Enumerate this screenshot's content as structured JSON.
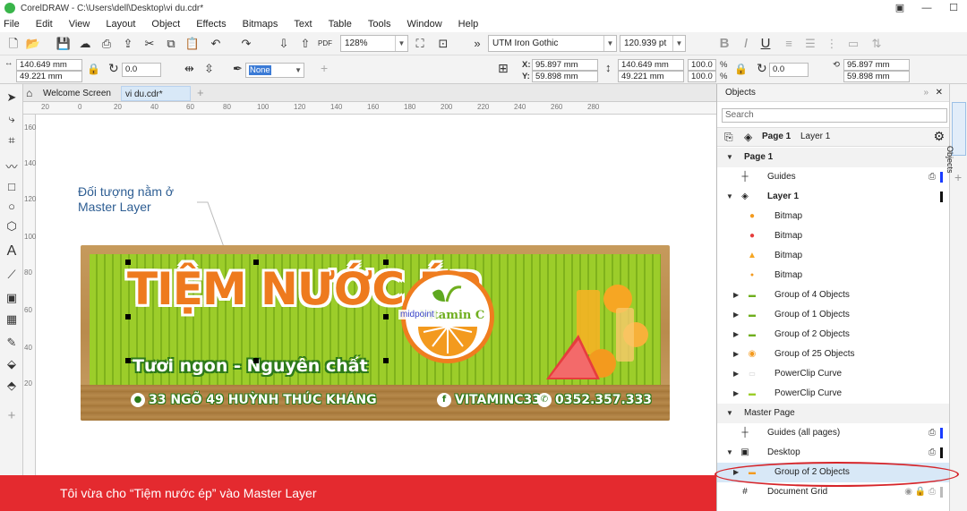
{
  "window": {
    "title": "CorelDRAW - C:\\Users\\dell\\Desktop\\vi du.cdr*"
  },
  "menu": [
    "File",
    "Edit",
    "View",
    "Layout",
    "Object",
    "Effects",
    "Bitmaps",
    "Text",
    "Table",
    "Tools",
    "Window",
    "Help"
  ],
  "toolbar": {
    "zoom": "128%",
    "font": "UTM Iron Gothic",
    "font_size": "120.939 pt",
    "bold": "B",
    "italic": "I",
    "underline": "U",
    "pdf": "PDF"
  },
  "propbar": {
    "width": "140.649 mm",
    "height": "49.221 mm",
    "angle": "0.0",
    "outline": "None",
    "x_label": "X:",
    "y_label": "Y:",
    "x": "95.897 mm",
    "y": "59.898 mm",
    "w2": "140.649 mm",
    "h2": "49.221 mm",
    "sx": "100.0",
    "sy": "100.0",
    "pct": "%",
    "rot": "0.0",
    "cx": "95.897 mm",
    "cy": "59.898 mm"
  },
  "tabs": {
    "welcome": "Welcome Screen",
    "doc": "vi du.cdr*"
  },
  "ruler": {
    "h": [
      "20",
      "0",
      "20",
      "40",
      "60",
      "80",
      "100",
      "120",
      "140",
      "160",
      "180",
      "200",
      "220",
      "240",
      "260",
      "280"
    ],
    "v": [
      "160",
      "140",
      "120",
      "100",
      "80",
      "60",
      "40",
      "20"
    ]
  },
  "canvas": {
    "annotation_line1": "Đối tượng nằm ở",
    "annotation_line2": "Master Layer",
    "midpoint": "midpoint",
    "banner": {
      "title": "TIỆM NƯỚC ÉP",
      "tagline": "Tươi ngon - Nguyên chất",
      "address": "33 NGÕ 49 HUỲNH THÚC KHÁNG",
      "facebook": "VITAMINC333",
      "phone": "0352.357.333",
      "logo_text": "Vitamin C"
    }
  },
  "objects": {
    "title": "Objects",
    "search_placeholder": "Search",
    "page_label": "Page 1",
    "layer_label": "Layer 1",
    "side_tab": "Objects",
    "rows": [
      {
        "label": "Page 1",
        "kind": "section"
      },
      {
        "label": "Guides",
        "kind": "item"
      },
      {
        "label": "Layer 1",
        "kind": "layer"
      },
      {
        "label": "Bitmap",
        "kind": "child"
      },
      {
        "label": "Bitmap",
        "kind": "child"
      },
      {
        "label": "Bitmap",
        "kind": "child"
      },
      {
        "label": "Bitmap",
        "kind": "child"
      },
      {
        "label": "Group of 4 Objects",
        "kind": "child"
      },
      {
        "label": "Group of 1 Objects",
        "kind": "child"
      },
      {
        "label": "Group of 2 Objects",
        "kind": "child"
      },
      {
        "label": "Group of 25 Objects",
        "kind": "child"
      },
      {
        "label": "PowerClip Curve",
        "kind": "child"
      },
      {
        "label": "PowerClip Curve",
        "kind": "child"
      },
      {
        "label": "Master Page",
        "kind": "section"
      },
      {
        "label": "Guides (all pages)",
        "kind": "item"
      },
      {
        "label": "Desktop",
        "kind": "layer"
      },
      {
        "label": "Group of 2 Objects",
        "kind": "child"
      },
      {
        "label": "Document Grid",
        "kind": "item"
      }
    ]
  },
  "caption": "Tôi vừa cho “Tiệm nước ép” vào Master Layer",
  "colors": {
    "caption_bg": "#e42a2f",
    "selection": "#d8e8f7",
    "highlight_ring": "#d6252a",
    "layer1_color": "#1a3cff",
    "banner_green": "#9ccd2a",
    "banner_orange": "#ee7a1e"
  }
}
